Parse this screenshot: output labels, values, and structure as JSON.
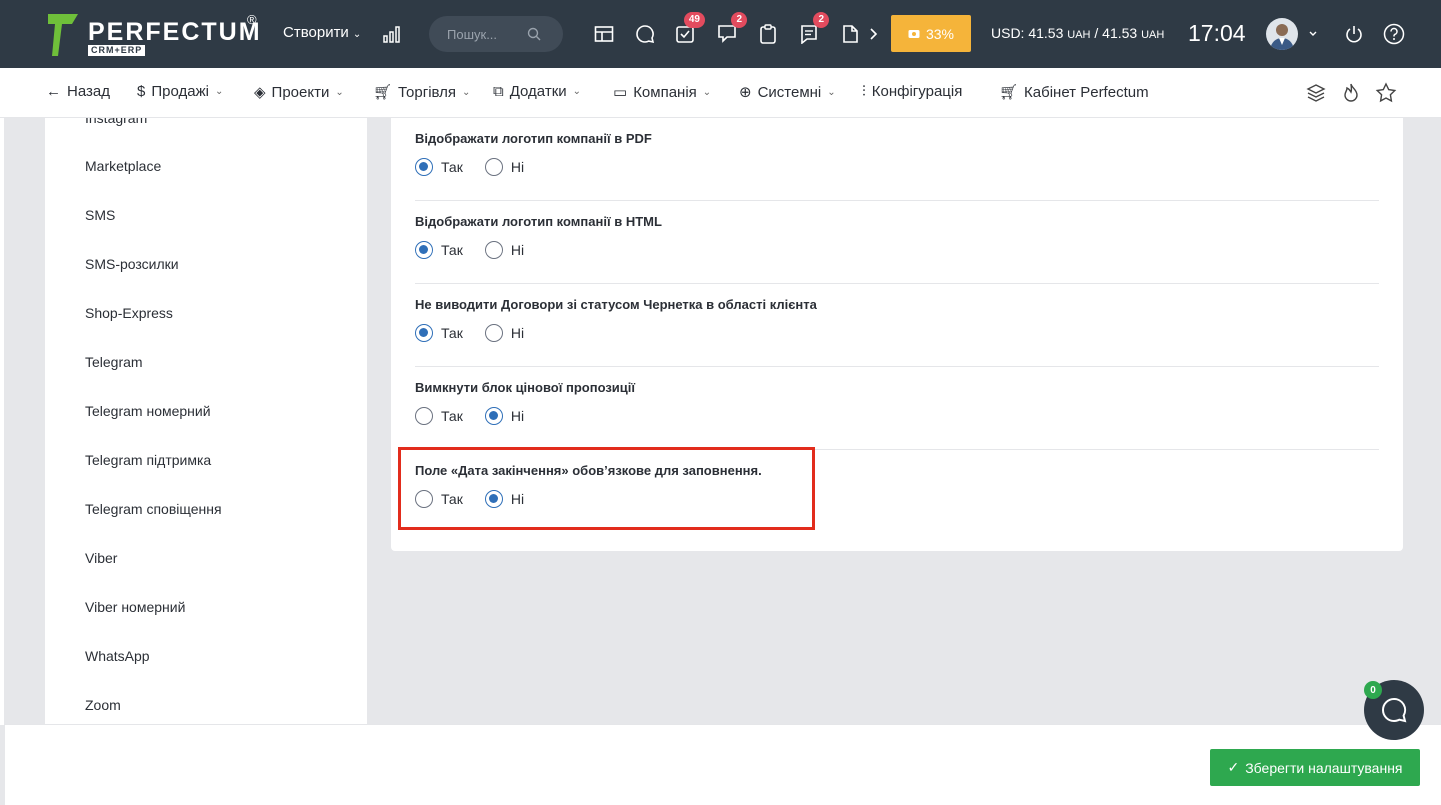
{
  "brand": {
    "name": "PERFECTUM",
    "reg": "®",
    "sub": "CRM+ERP"
  },
  "topbar": {
    "create_label": "Створити",
    "search_placeholder": "Пошук...",
    "badges": {
      "tasks": "49",
      "notifications": "2",
      "messages": "2"
    },
    "progress_label": "33%",
    "progress_value": 33,
    "rate": {
      "usd": "USD: 41.53",
      "uah1": "UAH",
      "sep": " / 41.53",
      "uah2": "UAH"
    },
    "time": "17:04"
  },
  "nav": {
    "back": "Назад",
    "sales": "Продажі",
    "projects": "Проекти",
    "trade": "Торгівля",
    "addons": "Додатки",
    "company": "Компанія",
    "system": "Системні",
    "config": "Конфігурація",
    "cabinet": "Кабінет Perfectum"
  },
  "sidebar": {
    "items": [
      "Instagram",
      "Marketplace",
      "SMS",
      "SMS-розсилки",
      "Shop-Express",
      "Telegram",
      "Telegram номерний",
      "Telegram підтримка",
      "Telegram сповіщення",
      "Viber",
      "Viber номерний",
      "WhatsApp",
      "Zoom"
    ]
  },
  "settings": {
    "yes_label": "Так",
    "no_label": "Ні",
    "items": [
      {
        "label": "Відображати логотип компанії в PDF",
        "value": "yes"
      },
      {
        "label": "Відображати логотип компанії в HTML",
        "value": "yes"
      },
      {
        "label": "Не виводити Договори зі статусом Чернетка в області клієнта",
        "value": "yes"
      },
      {
        "label": "Вимкнути блок цінової пропозиції",
        "value": "no"
      },
      {
        "label": "Поле «Дата закінчення» обов’язкове для заповнення.",
        "value": "no"
      }
    ]
  },
  "footer": {
    "save_label": "Зберегти налаштування"
  },
  "chat": {
    "badge": "0"
  },
  "colors": {
    "topbar": "#2f3a45",
    "accent": "#2f6fb8",
    "save": "#2ea84f",
    "highlight": "#e22c1c",
    "progress": "#f5b43a",
    "logo": "#6fbf3a"
  }
}
